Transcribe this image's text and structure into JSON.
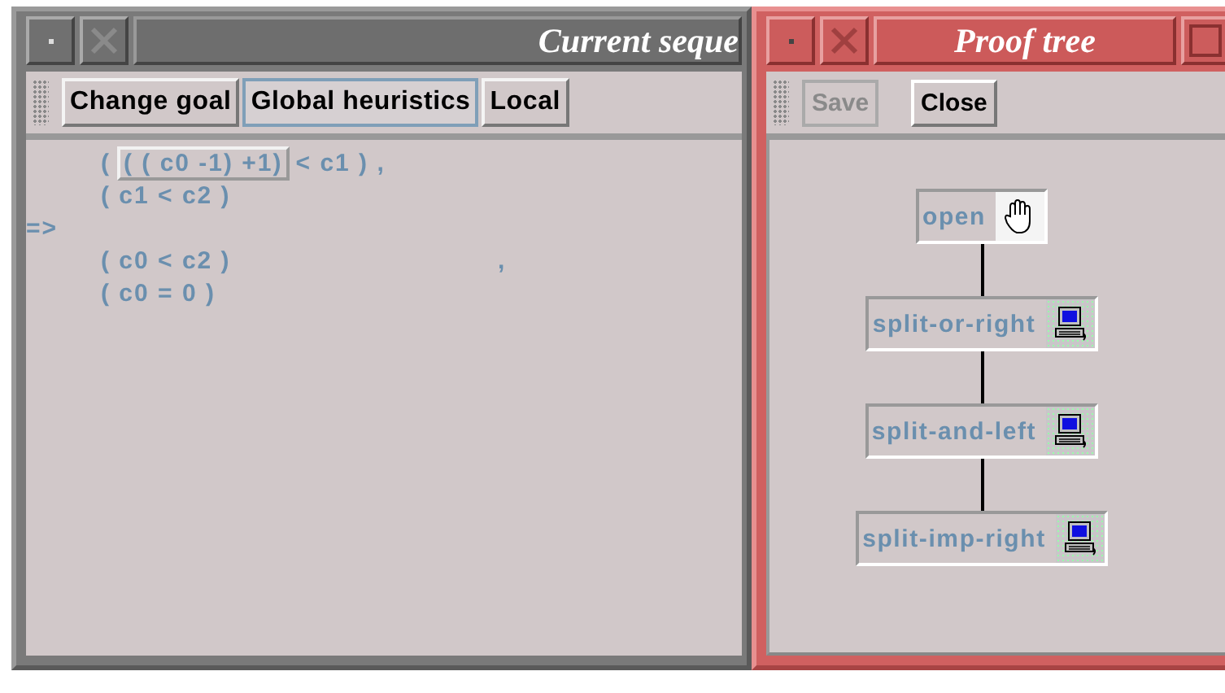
{
  "windows": [
    {
      "title": "Current seque",
      "focused": false,
      "toolbar": [
        {
          "label": "Change goal",
          "selected": false
        },
        {
          "label": "Global heuristics",
          "selected": true
        },
        {
          "label": "Local",
          "selected": false
        }
      ],
      "sequent": {
        "hypotheses": [
          {
            "before": "(",
            "highlight": "( ( c0 -1) +1)",
            "after": "< c1 ) ,"
          },
          {
            "before": "( c1 < c2 )"
          }
        ],
        "arrow": "=>",
        "goals": [
          {
            "before": "( c0 < c2 )",
            "trailing": ","
          },
          {
            "before": "( c0 = 0 )"
          }
        ]
      }
    },
    {
      "title": "Proof tree",
      "focused": true,
      "buttons": [
        {
          "label": "Save",
          "disabled": true
        },
        {
          "label": "Close",
          "disabled": false
        }
      ],
      "tree": {
        "label": "split-imp-right",
        "kind": "computer",
        "children": [
          {
            "label": "split-and-left",
            "kind": "computer",
            "children": [
              {
                "label": "split-or-right",
                "kind": "computer",
                "children": [
                  {
                    "label": "open",
                    "kind": "hand"
                  }
                ]
              }
            ]
          }
        ]
      }
    }
  ]
}
